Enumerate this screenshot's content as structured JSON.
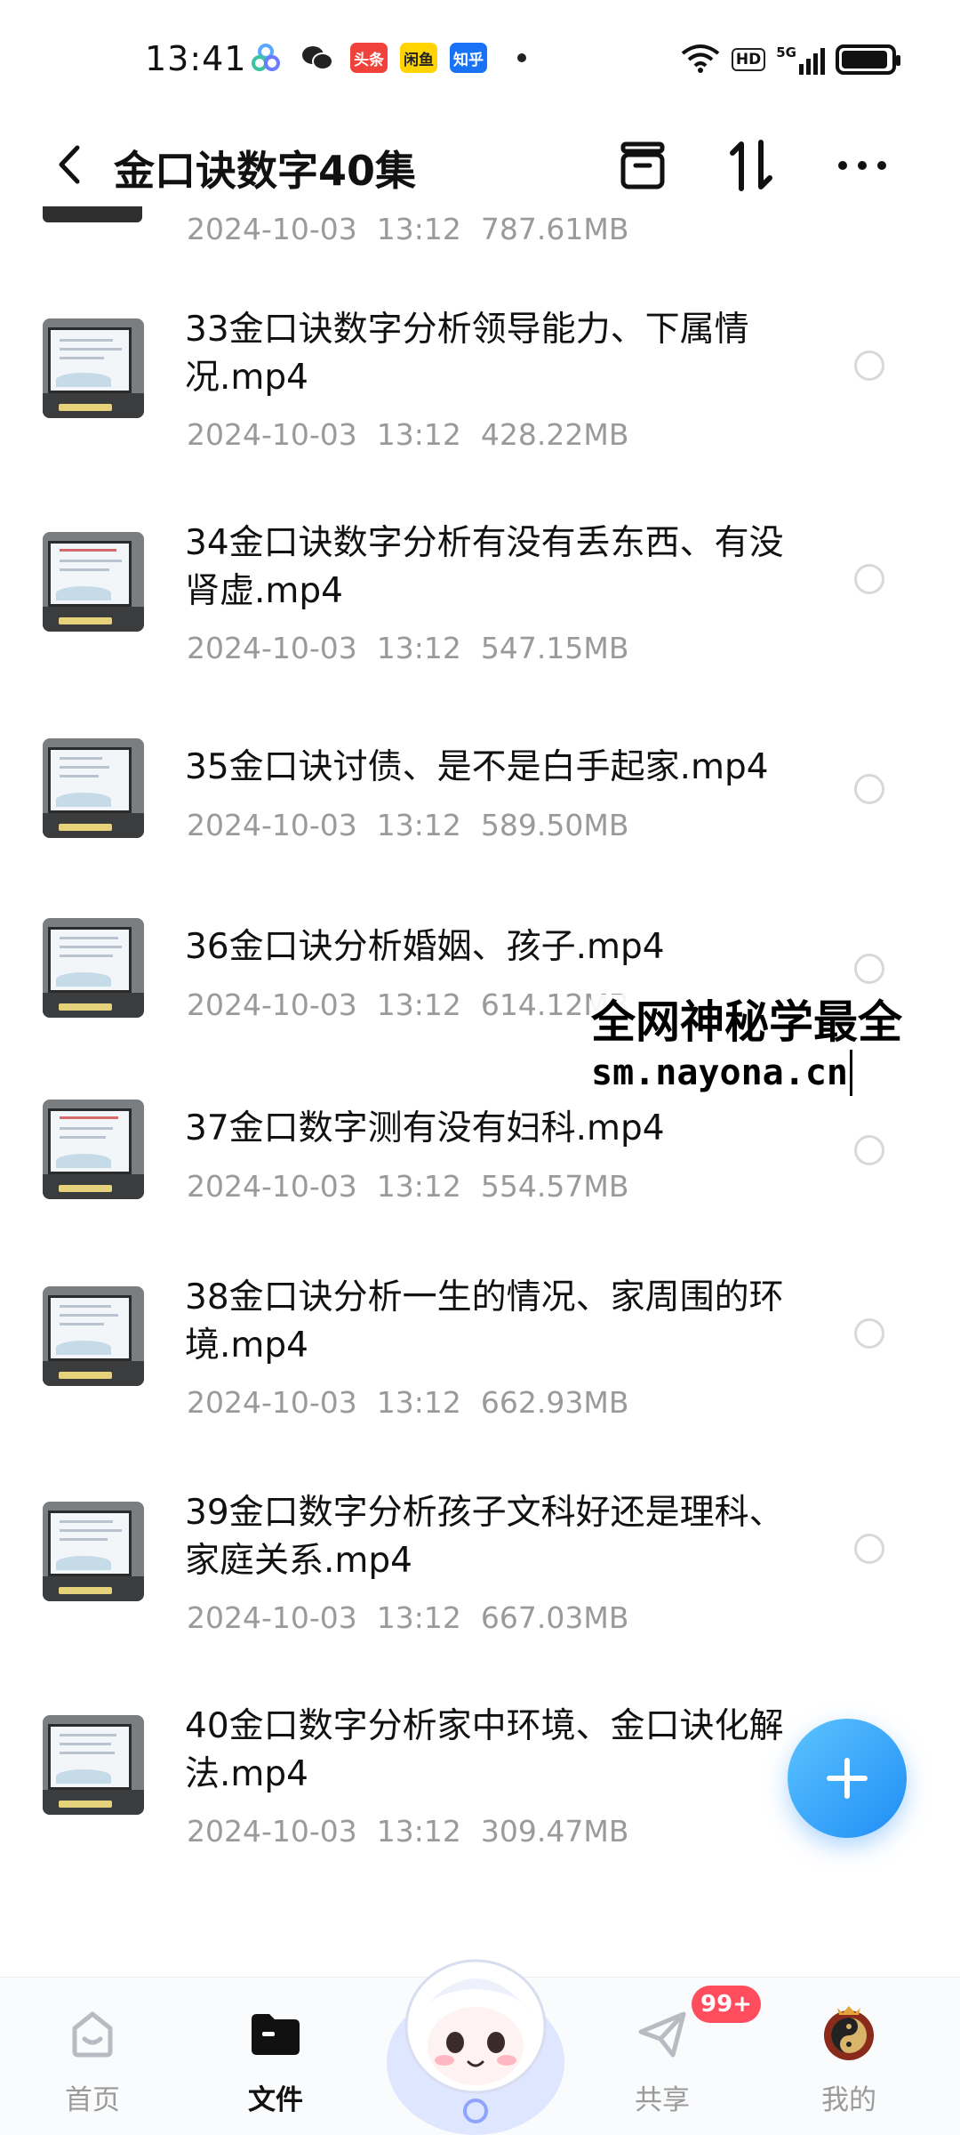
{
  "status_bar": {
    "time": "13:41",
    "apps": [
      {
        "name": "baidu-netdisk-icon",
        "label": "",
        "color": "#5aa9ff"
      },
      {
        "name": "wechat-icon",
        "label": "",
        "color": "#222222"
      },
      {
        "name": "toutiao-icon",
        "label": "头条",
        "color": "#f0413a"
      },
      {
        "name": "xianyu-icon",
        "label": "闲鱼",
        "color": "#ffd400"
      },
      {
        "name": "zhihu-icon",
        "label": "知乎",
        "color": "#1772f6"
      }
    ],
    "hd": "HD",
    "network": "5G",
    "battery_level": 0.95
  },
  "header": {
    "title": "金口诀数字40集"
  },
  "partial_row": {
    "date": "2024-10-03",
    "time": "13:12",
    "size": "787.61MB"
  },
  "files": [
    {
      "name": "33金口诀数字分析领导能力、下属情况.mp4",
      "date": "2024-10-03",
      "time": "13:12",
      "size": "428.22MB"
    },
    {
      "name": "34金口诀数字分析有没有丢东西、有没肾虚.mp4",
      "date": "2024-10-03",
      "time": "13:12",
      "size": "547.15MB"
    },
    {
      "name": "35金口诀讨债、是不是白手起家.mp4",
      "date": "2024-10-03",
      "time": "13:12",
      "size": "589.50MB"
    },
    {
      "name": "36金口诀分析婚姻、孩子.mp4",
      "date": "2024-10-03",
      "time": "13:12",
      "size": "614.12MB"
    },
    {
      "name": "37金口数字测有没有妇科.mp4",
      "date": "2024-10-03",
      "time": "13:12",
      "size": "554.57MB"
    },
    {
      "name": "38金口诀分析一生的情况、家周围的环境.mp4",
      "date": "2024-10-03",
      "time": "13:12",
      "size": "662.93MB"
    },
    {
      "name": "39金口数字分析孩子文科好还是理科、家庭关系.mp4",
      "date": "2024-10-03",
      "time": "13:12",
      "size": "667.03MB"
    },
    {
      "name": "40金口数字分析家中环境、金口诀化解法.mp4",
      "date": "2024-10-03",
      "time": "13:12",
      "size": "309.47MB"
    }
  ],
  "watermark": {
    "line1": "全网神秘学最全",
    "line2": "sm.nayona.cn"
  },
  "nav": {
    "home": "首页",
    "files": "文件",
    "share": "共享",
    "mine": "我的",
    "share_badge": "99+"
  },
  "colors": {
    "accent": "#1f8df5",
    "badge": "#ff4d5e"
  }
}
